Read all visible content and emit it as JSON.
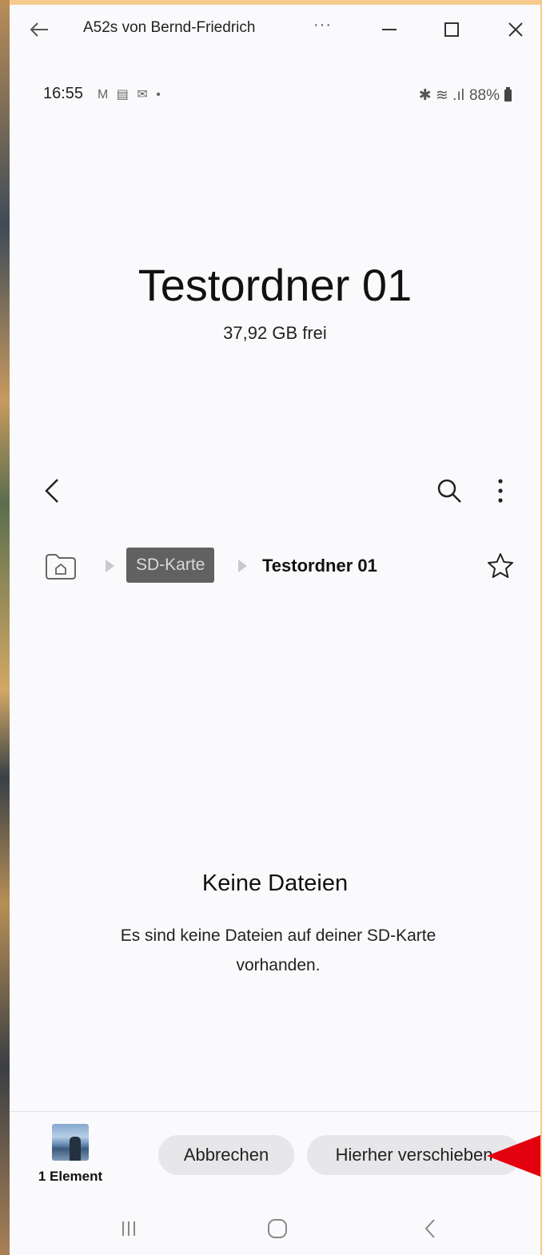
{
  "window": {
    "title": "A52s von Bernd-Friedrich",
    "more_label": "···"
  },
  "statusbar": {
    "time": "16:55",
    "left_icons": "M ▤ ✉ •",
    "right_icons": "✱ ≋ .ıl",
    "battery": "88%"
  },
  "folder": {
    "title": "Testordner 01",
    "free_space": "37,92 GB frei"
  },
  "breadcrumb": {
    "storage": "SD-Karte",
    "current": "Testordner 01"
  },
  "empty": {
    "title": "Keine Dateien",
    "text": "Es sind keine Dateien auf deiner SD-Karte vorhanden."
  },
  "bottom": {
    "selection_label": "1 Element",
    "cancel_label": "Abbrechen",
    "move_label": "Hierher verschieben"
  },
  "colors": {
    "background": "#fafafc",
    "button_bg": "#e7e7ea",
    "breadcrumb_chip": "#616161",
    "annotation_arrow": "#e3000f"
  }
}
